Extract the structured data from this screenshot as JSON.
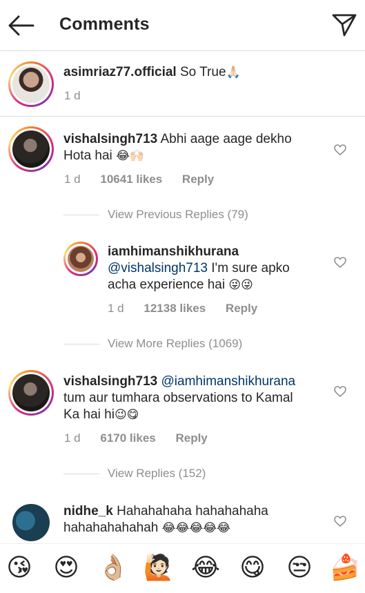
{
  "header": {
    "title": "Comments",
    "back_icon": "arrow-left-icon",
    "send_icon": "paper-plane-icon"
  },
  "caption": {
    "username": "asimriaz77.official",
    "text": "So True",
    "emoji": "🙏🏻",
    "time": "1 d"
  },
  "comments": [
    {
      "username": "vishalsingh713",
      "text_line1": "Abhi aage aage dekho",
      "text_line2": "Hota hai",
      "emoji": "😂🙌🏻",
      "time": "1 d",
      "likes": "10641 likes",
      "reply": "Reply"
    },
    {
      "view_replies": "View Previous Replies (79)"
    },
    {
      "username": "iamhimanshikhurana",
      "mention": "@vishalsingh713",
      "text_line1": "I'm sure apko",
      "text_line2": "acha experience hai",
      "emoji": "😜😜",
      "time": "1 d",
      "likes": "12138 likes",
      "reply": "Reply"
    },
    {
      "view_replies": "View More Replies (1069)"
    },
    {
      "username": "vishalsingh713",
      "mention": "@iamhimanshikhurana",
      "text_line1": "tum aur tumhara observations to Kamal",
      "text_line2": "Ka hai hi",
      "emoji": "😉😋",
      "time": "1 d",
      "likes": "6170 likes",
      "reply": "Reply"
    },
    {
      "view_replies": "View Replies (152)"
    },
    {
      "username": "nidhe_k",
      "text_line1": "Hahahahaha hahahahaha",
      "text_line2": "hahahahahahah",
      "emoji": "😂😂😂😂😂"
    }
  ],
  "emoji_bar": [
    "😘",
    "😍",
    "👌🏼",
    "🙋🏻",
    "😂",
    "😋",
    "😒",
    "🍰"
  ]
}
